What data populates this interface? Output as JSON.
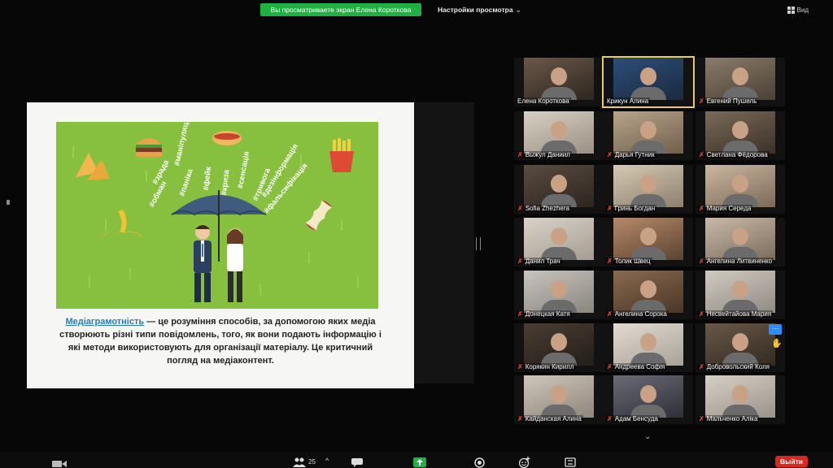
{
  "top_bar": {
    "sharing_banner": "Вы просматриваете экран Елена Короткова",
    "view_options": "Настройки просмотра",
    "view_label": "Вид"
  },
  "slide": {
    "hashtags": [
      "#обман",
      "#зрада",
      "#паніка",
      "#маніпуляція",
      "#фейк",
      "#криза",
      "#сенсація",
      "#тривога",
      "#дезінформація",
      "#фальсифікація"
    ],
    "term": "Медіаграмотність",
    "text": " — це розуміння способів, за допомогою яких медіа створюють різні типи повідомлень, того, як вони подають інформацію і які методи використовують для організації матеріалу. Це критичний погляд на медіаконтент."
  },
  "participants": [
    {
      "name": "Елена Короткова",
      "muted": false
    },
    {
      "name": "Крикун Алина",
      "muted": false
    },
    {
      "name": "Евгений Пушель",
      "muted": true
    },
    {
      "name": "Выжул Даниил",
      "muted": true
    },
    {
      "name": "Дарья Гутник",
      "muted": true
    },
    {
      "name": "Светлана Фёдорова",
      "muted": true
    },
    {
      "name": "Sofia Zhezhera",
      "muted": true
    },
    {
      "name": "Гринь Богдан",
      "muted": true
    },
    {
      "name": "Мария Середа",
      "muted": true
    },
    {
      "name": "Данил Трач",
      "muted": true
    },
    {
      "name": "Толик Швец",
      "muted": true
    },
    {
      "name": "Ангелина Литвиненко",
      "muted": true
    },
    {
      "name": "Донецкая Катя",
      "muted": true
    },
    {
      "name": "Ангелина Сорока",
      "muted": true
    },
    {
      "name": "Несвейтайова Мария",
      "muted": true
    },
    {
      "name": "Корякин Кирилл",
      "muted": true
    },
    {
      "name": "Андреева Софія",
      "muted": true
    },
    {
      "name": "Добровольский Коля",
      "muted": true
    },
    {
      "name": "Кайданская Алина",
      "muted": true
    },
    {
      "name": "Адам Бенсуда",
      "muted": true
    },
    {
      "name": "Мальченко Аліка",
      "muted": true
    }
  ],
  "more_label": "···",
  "toolbar": {
    "participants_count": "25",
    "leave": "Выйти",
    "icons": [
      "video-icon",
      "participants-icon",
      "chat-icon",
      "share-screen-icon",
      "record-icon",
      "reactions-icon",
      "more-icon"
    ]
  },
  "colors": {
    "share_banner": "#1fb141",
    "active_speaker": "#e7cf58",
    "leave_button": "#d6281e",
    "slide_background": "#87c03f"
  }
}
